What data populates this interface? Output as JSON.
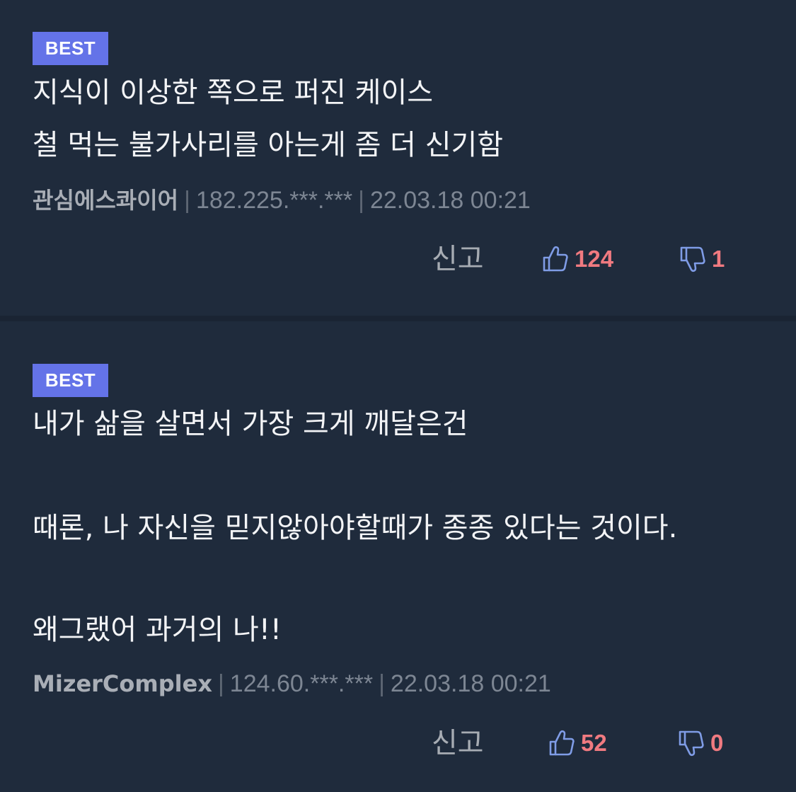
{
  "comments": [
    {
      "badge": "BEST",
      "lines": [
        "지식이 이상한 쪽으로 퍼진 케이스",
        "철 먹는 불가사리를 아는게 좀 더 신기함"
      ],
      "author": "관심에스콰이어",
      "ip": "182.225.***.***",
      "date": "22.03.18 00:21",
      "report_label": "신고",
      "likes": "124",
      "dislikes": "1"
    },
    {
      "badge": "BEST",
      "lines": [
        "내가 삶을 살면서 가장 크게 깨달은건",
        "",
        "때론, 나 자신을 믿지않아야할때가 종종 있다는 것이다.",
        "",
        "왜그랬어 과거의 나!!"
      ],
      "author": "MizerComplex",
      "ip": "124.60.***.***",
      "date": "22.03.18 00:21",
      "report_label": "신고",
      "likes": "52",
      "dislikes": "0"
    }
  ],
  "colors": {
    "background": "#1f2b3c",
    "badge": "#6473e8",
    "vote_count": "#f07a80",
    "thumb_icon": "#7f9ce6"
  },
  "icons": {
    "like": "thumbs-up-icon",
    "dislike": "thumbs-down-icon"
  }
}
